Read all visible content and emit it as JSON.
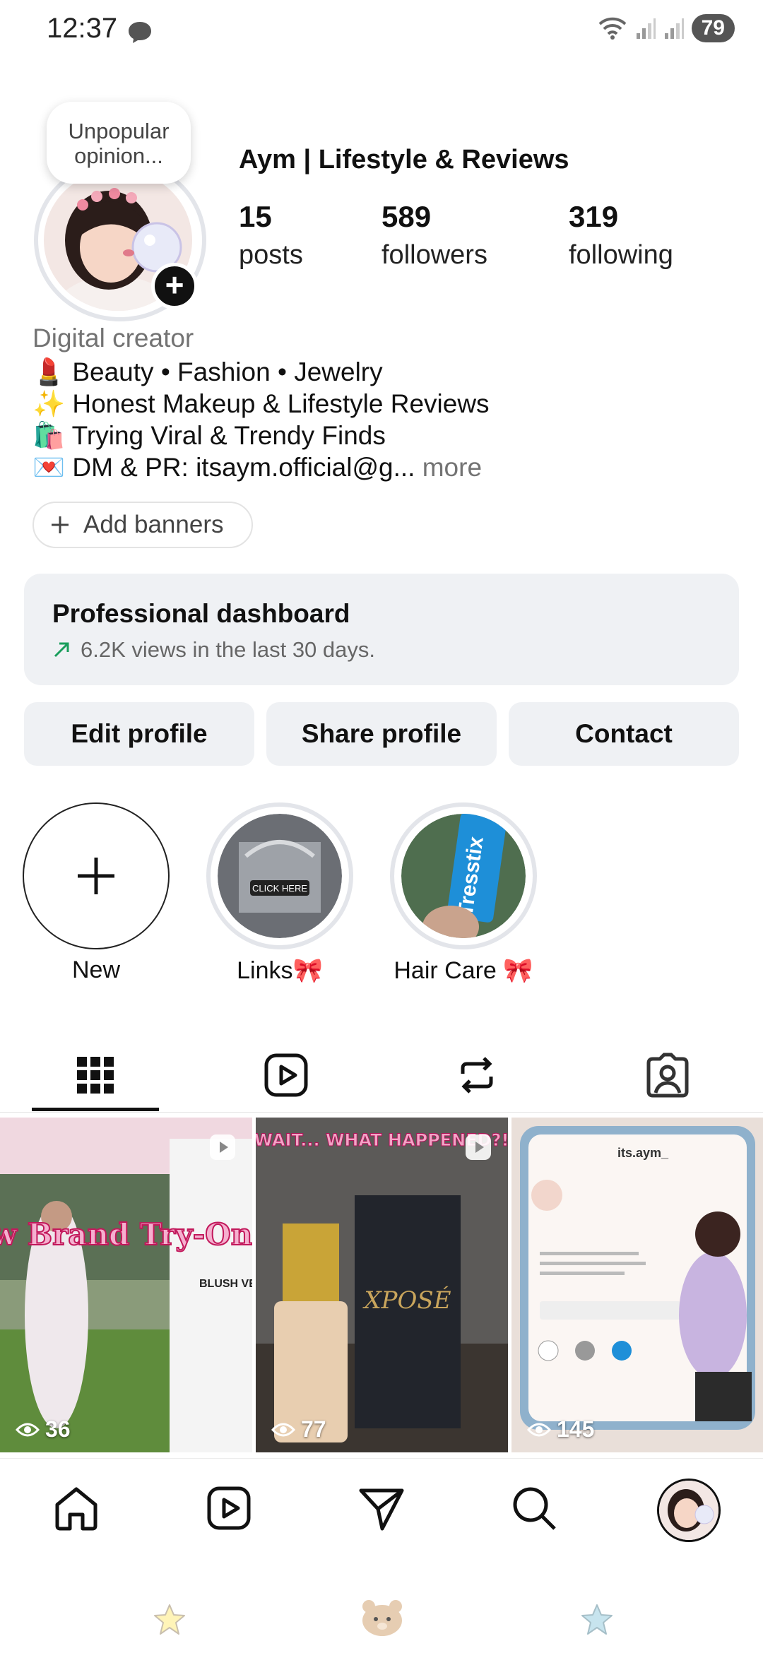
{
  "status_bar": {
    "time": "12:37",
    "battery": "79"
  },
  "profile": {
    "note": "Unpopular opinion...",
    "display_name": "Aym | Lifestyle & Reviews",
    "stats": [
      {
        "value": "15",
        "label": "posts"
      },
      {
        "value": "589",
        "label": "followers"
      },
      {
        "value": "319",
        "label": "following"
      }
    ],
    "category": "Digital creator",
    "bio": [
      "💄 Beauty • Fashion • Jewelry",
      "✨ Honest Makeup & Lifestyle Reviews",
      "🛍️ Trying Viral & Trendy Finds",
      "💌 DM & PR: itsaym.official@g..."
    ],
    "bio_more": "more",
    "add_banners": "Add banners"
  },
  "dashboard": {
    "title": "Professional dashboard",
    "subtitle": "6.2K views in the last 30 days."
  },
  "actions": {
    "edit": "Edit profile",
    "share": "Share profile",
    "contact": "Contact"
  },
  "highlights": [
    {
      "label": "New"
    },
    {
      "label": "Links🎀",
      "image_text": "CLICK HERE"
    },
    {
      "label": "Hair Care 🎀",
      "image_text": "Tresstix"
    }
  ],
  "posts": [
    {
      "views": "36",
      "overlay_title": "New Brand Try-On",
      "side_text": "BLUSH VE",
      "type": "reel"
    },
    {
      "views": "77",
      "overlay_title": "\"WAIT... WHAT HAPPENED?!\"",
      "product": "XPOSÉ",
      "type": "reel"
    },
    {
      "views": "145",
      "header": "its.aym_",
      "type": "post"
    }
  ],
  "icons": {
    "tabs": [
      "grid-icon",
      "reels-icon",
      "reposts-icon",
      "tagged-icon"
    ],
    "nav": [
      "home-icon",
      "reels-icon",
      "send-icon",
      "search-icon",
      "profile-avatar"
    ]
  },
  "colors": {
    "accent": "#111111",
    "secondary_bg": "#eff1f4",
    "muted_text": "#737373",
    "trend_green": "#1a9e5c"
  }
}
